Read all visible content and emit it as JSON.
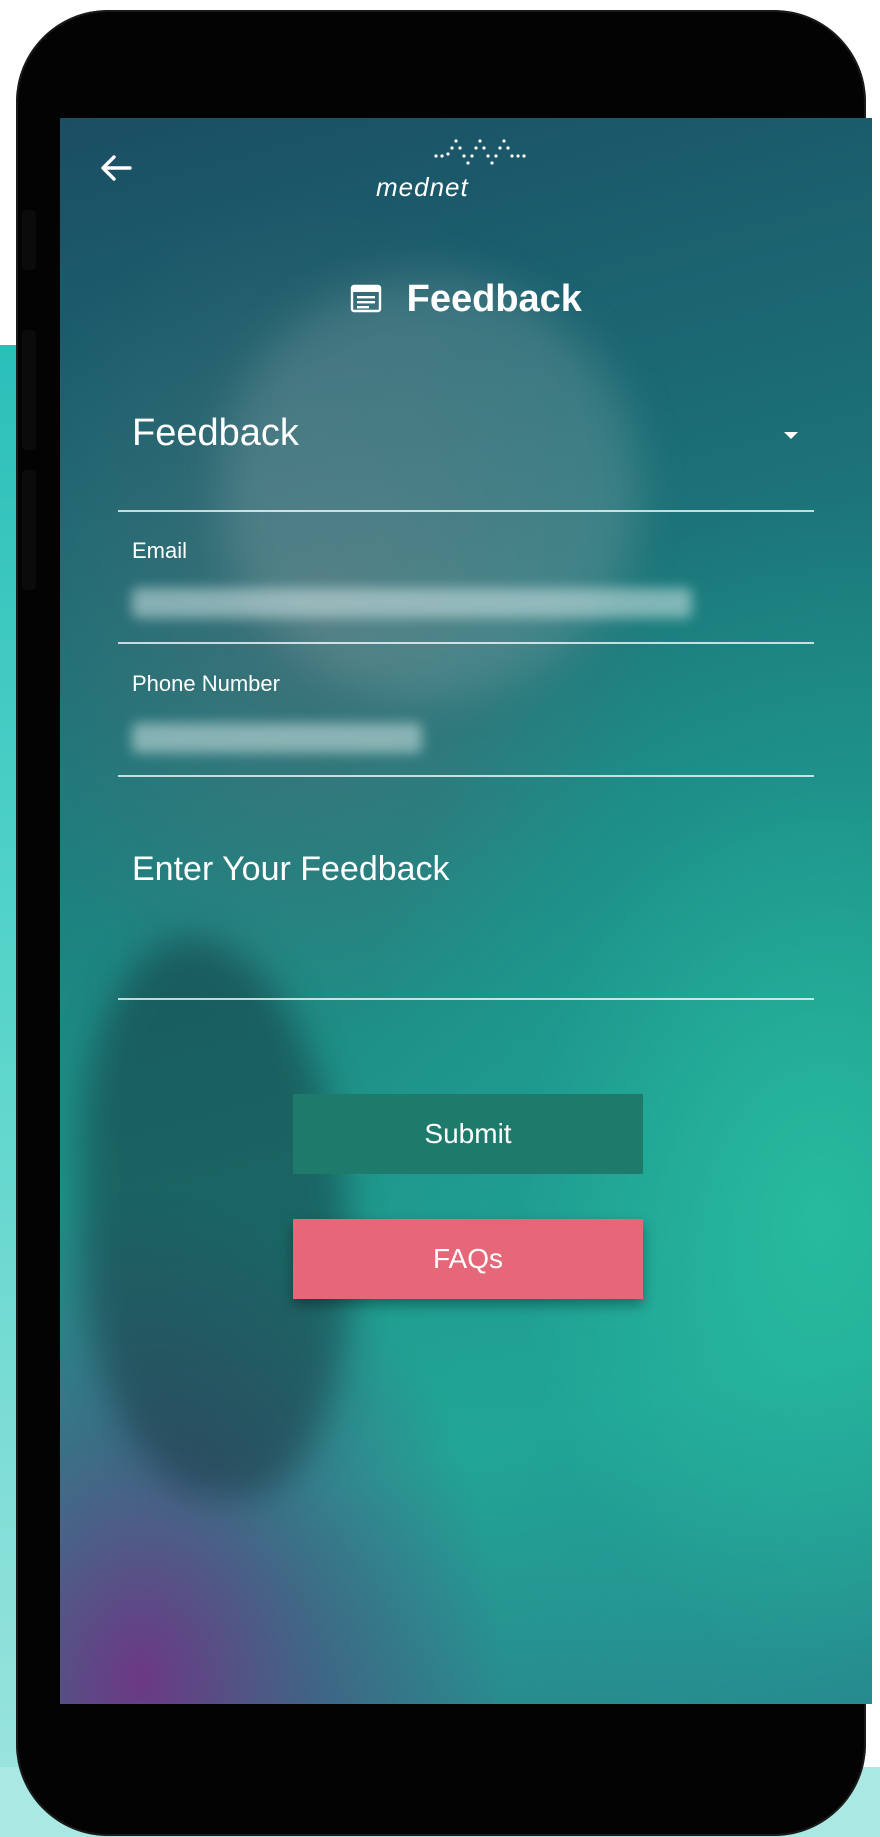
{
  "app": {
    "name": "mednet"
  },
  "page": {
    "title": "Feedback"
  },
  "form": {
    "type_select": {
      "value": "Feedback"
    },
    "email": {
      "label": "Email"
    },
    "phone": {
      "label": "Phone Number"
    },
    "feedback": {
      "placeholder": "Enter Your Feedback"
    }
  },
  "actions": {
    "submit_label": "Submit",
    "faqs_label": "FAQs"
  },
  "colors": {
    "submit_button": "#1e7a6a",
    "faqs_button": "#e66878",
    "gradient_teal": "#22a796",
    "gradient_purple": "#78288a"
  },
  "icons": {
    "back": "arrow-left-icon",
    "logo": "mednet-waveform-logo",
    "title": "feedback-form-icon",
    "select": "caret-down-icon"
  }
}
